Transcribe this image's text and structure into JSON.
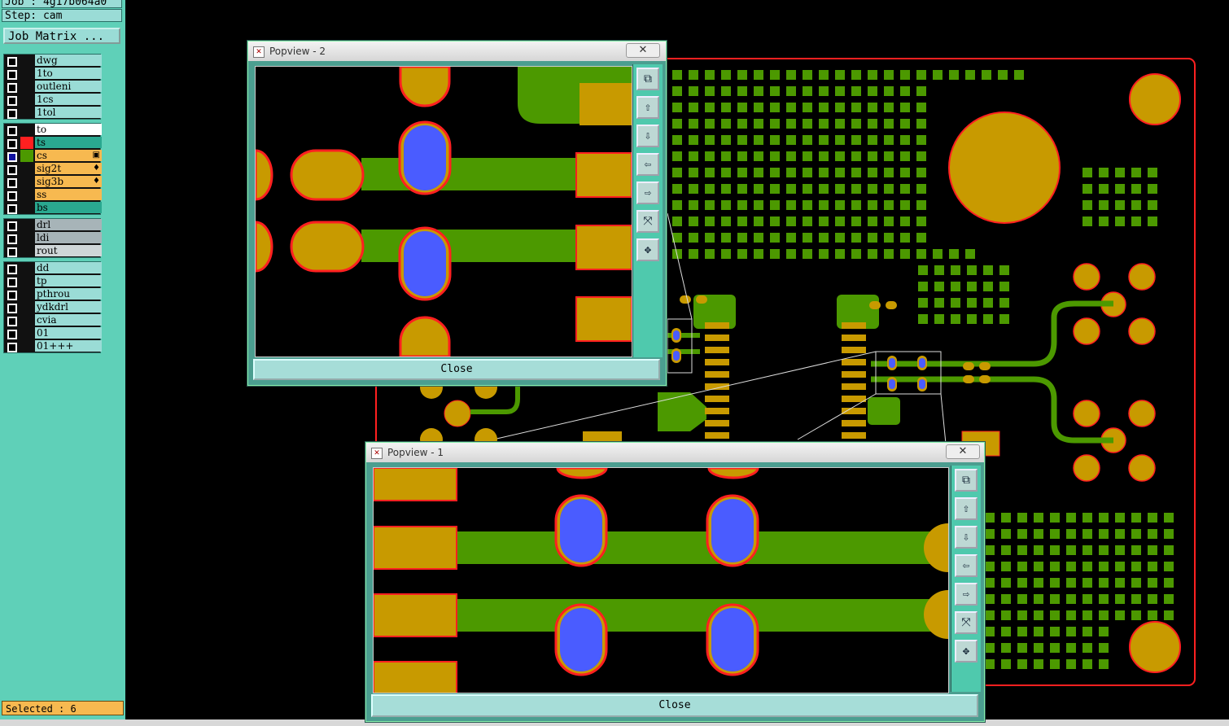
{
  "job_label": "Job : 4g17b064a0",
  "step_label": "Step: cam",
  "job_matrix_button": "Job Matrix ...",
  "layers_group1": [
    "dwg",
    "1to",
    "outleni",
    "1cs",
    "1tol"
  ],
  "layers_group2": [
    "to",
    "ts",
    "cs",
    "sig2t",
    "sig3b",
    "ss",
    "bs"
  ],
  "layers_group3": [
    "drl",
    "ldi",
    "rout"
  ],
  "layers_group4": [
    "dd",
    "tp",
    "pthrou",
    "ydkdrl",
    "cvia",
    "01",
    "01+++"
  ],
  "selected_label": "Selected : 6",
  "popview2": {
    "title": "Popview - 2",
    "close_label": "Close",
    "x_label": "✕"
  },
  "popview1": {
    "title": "Popview - 1",
    "close_label": "Close",
    "x_label": "✕"
  },
  "colors": {
    "board_outline": "#ff2020",
    "pad": "#c89a00",
    "trace": "#4c9900",
    "via": "#4a5cff",
    "panel": "#5fd0b8"
  },
  "toolbar_icons": [
    "zoom-window-icon",
    "move-up-icon",
    "move-down-icon",
    "move-left-icon",
    "move-right-icon",
    "zoom-out-icon",
    "zoom-fit-icon"
  ]
}
